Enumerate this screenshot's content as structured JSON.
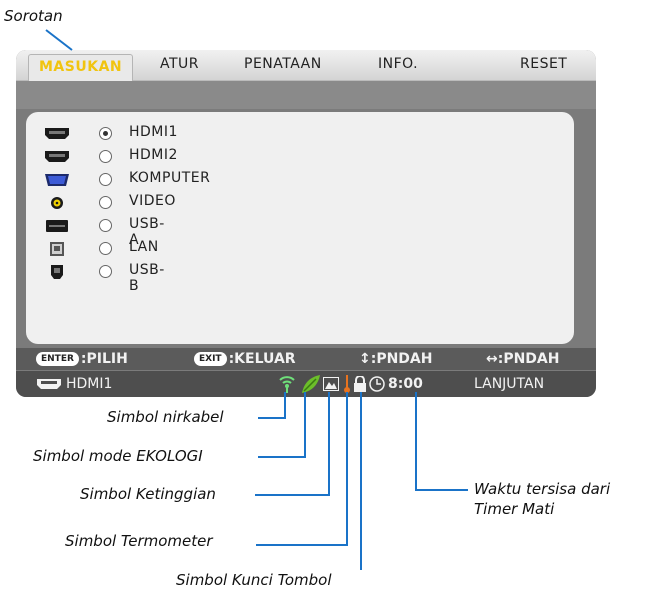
{
  "callouts": {
    "sorotan": "Sorotan",
    "wireless": "Simbol nirkabel",
    "eco": "Simbol mode EKOLOGI",
    "altitude": "Simbol Ketinggian",
    "thermometer": "Simbol Termometer",
    "key_lock": "Simbol Kunci Tombol",
    "timer_line1": "Waktu tersisa dari",
    "timer_line2": "Timer Mati"
  },
  "menu": {
    "tabs": [
      {
        "label": "MASUKAN",
        "active": true
      },
      {
        "label": "ATUR",
        "active": false
      },
      {
        "label": "PENATAAN",
        "active": false
      },
      {
        "label": "INFO.",
        "active": false
      },
      {
        "label": "RESET",
        "active": false
      }
    ]
  },
  "inputs": [
    {
      "label": "HDMI1",
      "selected": true,
      "icon": "hdmi-icon"
    },
    {
      "label": "HDMI2",
      "selected": false,
      "icon": "hdmi-icon"
    },
    {
      "label": "KOMPUTER",
      "selected": false,
      "icon": "vga-icon"
    },
    {
      "label": "VIDEO",
      "selected": false,
      "icon": "rca-icon"
    },
    {
      "label": "USB-A",
      "selected": false,
      "icon": "usb-a-icon"
    },
    {
      "label": "LAN",
      "selected": false,
      "icon": "lan-icon"
    },
    {
      "label": "USB-B",
      "selected": false,
      "icon": "usb-b-icon"
    }
  ],
  "guide": {
    "enter_key": "ENTER",
    "enter_text": ":PILIH",
    "exit_key": "EXIT",
    "exit_text": ":KELUAR",
    "updown_text": "↕:PNDAH",
    "leftright_text": "↔:PNDAH"
  },
  "status": {
    "source": "HDMI1",
    "timer": "8:00",
    "mode": "LANJUTAN"
  },
  "colors": {
    "active_tab_text": "#f1c40f",
    "callout_line": "#1a73c8",
    "eco_green": "#6cbf2a",
    "thermo_orange": "#e8731f"
  }
}
